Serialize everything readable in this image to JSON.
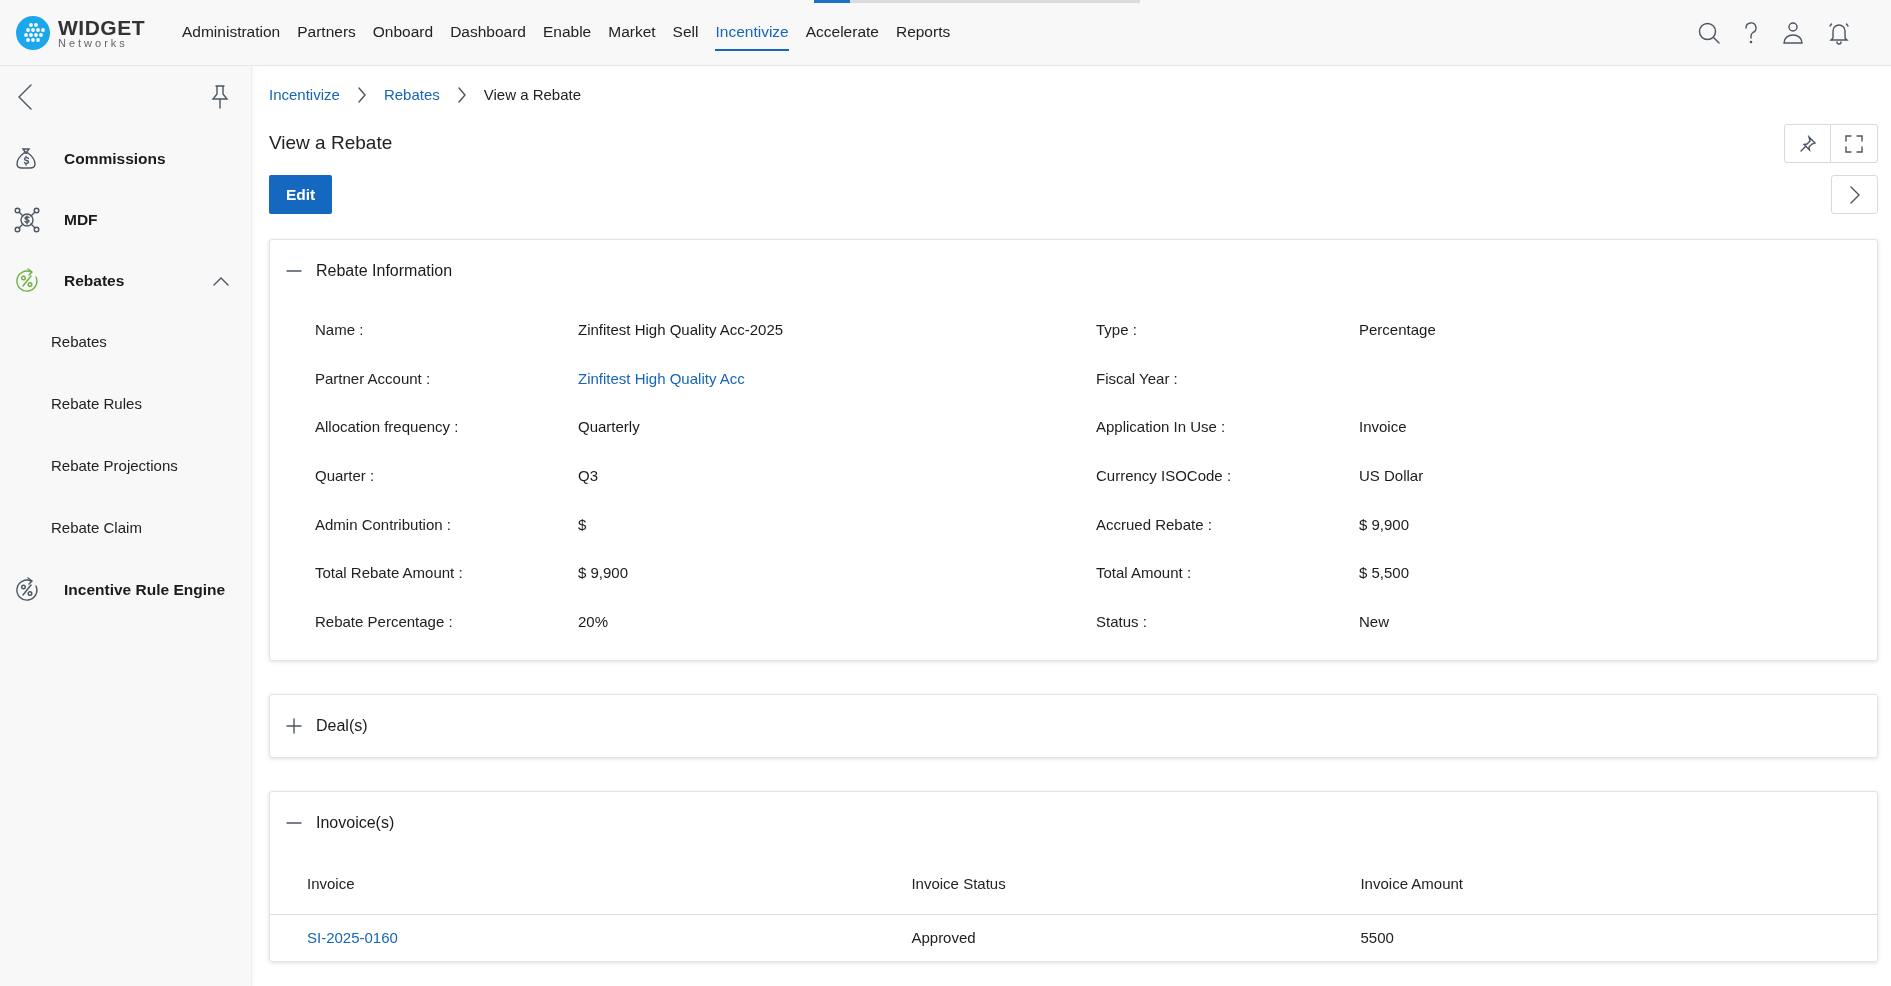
{
  "brand": {
    "name": "WIDGET",
    "tagline": "Networks"
  },
  "loading_bar": {
    "level": 0.11
  },
  "top_nav": [
    {
      "label": "Administration",
      "selected": false
    },
    {
      "label": "Partners",
      "selected": false
    },
    {
      "label": "Onboard",
      "selected": false
    },
    {
      "label": "Dashboard",
      "selected": false
    },
    {
      "label": "Enable",
      "selected": false
    },
    {
      "label": "Market",
      "selected": false
    },
    {
      "label": "Sell",
      "selected": false
    },
    {
      "label": "Incentivize",
      "selected": true
    },
    {
      "label": "Accelerate",
      "selected": false
    },
    {
      "label": "Reports",
      "selected": false
    }
  ],
  "sidebar": {
    "items": [
      {
        "label": "Commissions",
        "selected": false
      },
      {
        "label": "MDF",
        "selected": false
      },
      {
        "label": "Rebates",
        "selected": true,
        "expanded": true,
        "children": [
          {
            "label": "Rebates"
          },
          {
            "label": "Rebate Rules"
          },
          {
            "label": "Rebate Projections"
          },
          {
            "label": "Rebate Claim"
          }
        ]
      },
      {
        "label": "Incentive Rule Engine",
        "selected": false
      }
    ]
  },
  "breadcrumb": [
    {
      "label": "Incentivize",
      "kind": "link"
    },
    {
      "label": "Rebates",
      "kind": "link"
    },
    {
      "label": "View a Rebate",
      "kind": "current"
    }
  ],
  "page_title": "View a Rebate",
  "edit_button": "Edit",
  "sections": [
    {
      "title": "Rebate Information",
      "expanded": true,
      "kind": "fields",
      "fields": [
        {
          "label": "Name :",
          "value": "Zinfitest High Quality Acc-2025"
        },
        {
          "label": "Type :",
          "value": "Percentage"
        },
        {
          "label": "Partner Account :",
          "value": "Zinfitest High Quality Acc",
          "kind": "link"
        },
        {
          "label": "Fiscal Year :"
        },
        {
          "label": "Allocation frequency :",
          "value": "Quarterly"
        },
        {
          "label": "Application In Use :",
          "value": "Invoice"
        },
        {
          "label": "Quarter :",
          "value": "Q3"
        },
        {
          "label": "Currency ISOCode :",
          "value": "US Dollar"
        },
        {
          "label": "Admin Contribution :",
          "value": "$"
        },
        {
          "label": "Accrued Rebate :",
          "value": "$ 9,900"
        },
        {
          "label": "Total Rebate Amount :",
          "value": "$ 9,900"
        },
        {
          "label": "Total Amount :",
          "value": "$ 5,500"
        },
        {
          "label": "Rebate Percentage :",
          "value": "20%"
        },
        {
          "label": "Status :",
          "value": "New"
        }
      ]
    },
    {
      "title": "Deal(s)",
      "expanded": false
    },
    {
      "title": "Inovoice(s)",
      "expanded": true,
      "kind": "table",
      "table": {
        "columns": [
          "Invoice",
          "Invoice Status",
          "Invoice Amount"
        ],
        "rows": [
          [
            "SI-2025-0160",
            "Approved",
            "5500"
          ]
        ]
      }
    }
  ]
}
